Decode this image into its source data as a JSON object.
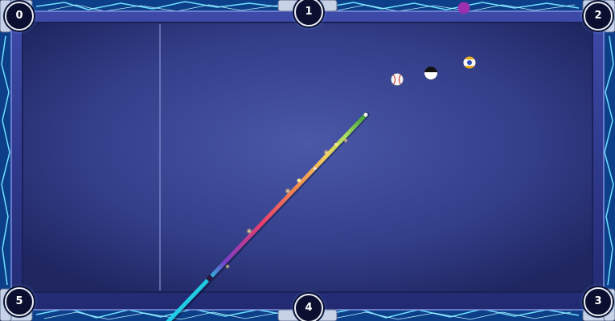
{
  "game": "pool",
  "pockets": [
    {
      "id": "0",
      "label": "0"
    },
    {
      "id": "1",
      "label": "1"
    },
    {
      "id": "2",
      "label": "2"
    },
    {
      "id": "3",
      "label": "3"
    },
    {
      "id": "4",
      "label": "4"
    },
    {
      "id": "5",
      "label": "5"
    }
  ],
  "balls": [
    {
      "name": "cue-ball",
      "kind": "white with red stitches",
      "color": "#f4f4f4",
      "accent": "#d84040"
    },
    {
      "name": "eight-ball",
      "kind": "black",
      "color": "#111111",
      "accent": "#ffffff"
    },
    {
      "name": "nine-ball",
      "kind": "yellow stripe",
      "color": "#e8b020",
      "accent": "#2d4fb0"
    },
    {
      "name": "purple-ball",
      "kind": "solid purple",
      "color": "#9b2fae",
      "accent": "#9b2fae"
    }
  ],
  "colors": {
    "felt_center": "#4a58a8",
    "felt_edge": "#1f2660",
    "rail": "#2f3a8e",
    "lightning": "#4fc8ff",
    "cue_gradient": [
      "#1fd0e8",
      "#7a3cc8",
      "#e83d6e",
      "#f0d060",
      "#a8e060",
      "#3a9a3a"
    ]
  }
}
